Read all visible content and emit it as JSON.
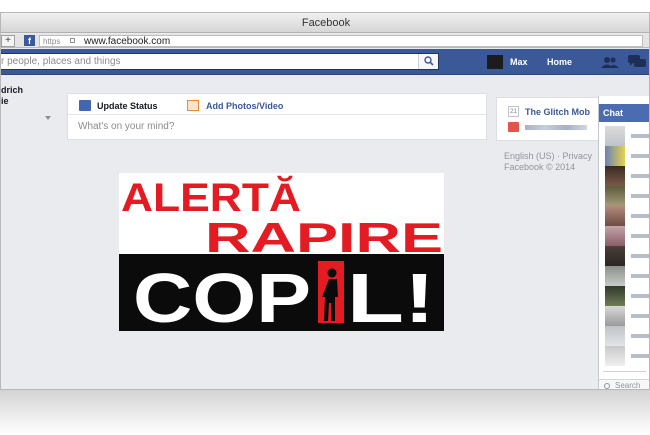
{
  "window": {
    "title": "Facebook"
  },
  "address_bar": {
    "scheme": "https",
    "url": "www.facebook.com",
    "plus": "+"
  },
  "fb_header": {
    "search_placeholder": "r people, places and things",
    "user_name": "Max",
    "home_label": "Home"
  },
  "left_column": {
    "name_line1": "drich",
    "name_line2": "ie"
  },
  "composer": {
    "update_status": "Update Status",
    "add_photos": "Add Photos/Video",
    "placeholder": "What's on your mind?"
  },
  "alert_image": {
    "line1": "ALERTĂ",
    "line2": "RAPIRE",
    "line3": "COP",
    "line3_end": "L!",
    "colors": {
      "red": "#e31b23",
      "black": "#0b0b0b",
      "white": "#ffffff"
    }
  },
  "right_column": {
    "calendar_day": "21",
    "event": "The Glitch Mob",
    "footer_line1": "English (US) · Privacy",
    "footer_line2": "Facebook © 2014"
  },
  "chat": {
    "title": "Chat",
    "search_placeholder": "Search"
  },
  "colors": {
    "fb_blue": "#3b5998",
    "chat_blue": "#4c6cb1",
    "page_bg": "#e9ebee"
  }
}
